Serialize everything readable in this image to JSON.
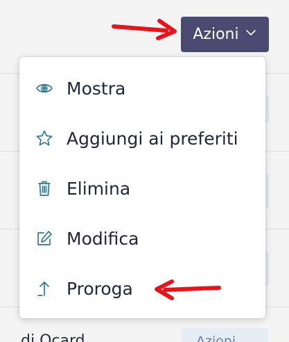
{
  "trigger": {
    "label": "Azioni",
    "icon": "chevron-down-icon"
  },
  "menu": {
    "items": [
      {
        "label": "Mostra",
        "icon": "eye-icon"
      },
      {
        "label": "Aggiungi ai preferiti",
        "icon": "star-icon"
      },
      {
        "label": "Elimina",
        "icon": "trash-icon"
      },
      {
        "label": "Modifica",
        "icon": "edit-icon"
      },
      {
        "label": "Proroga",
        "icon": "arrow-up-icon"
      }
    ]
  },
  "background": {
    "row_text": "di Ocard",
    "row_button_label": "Azioni"
  },
  "colors": {
    "trigger_bg": "#4a4a70",
    "icon": "#2f7893",
    "annotation": "#e8141c"
  }
}
